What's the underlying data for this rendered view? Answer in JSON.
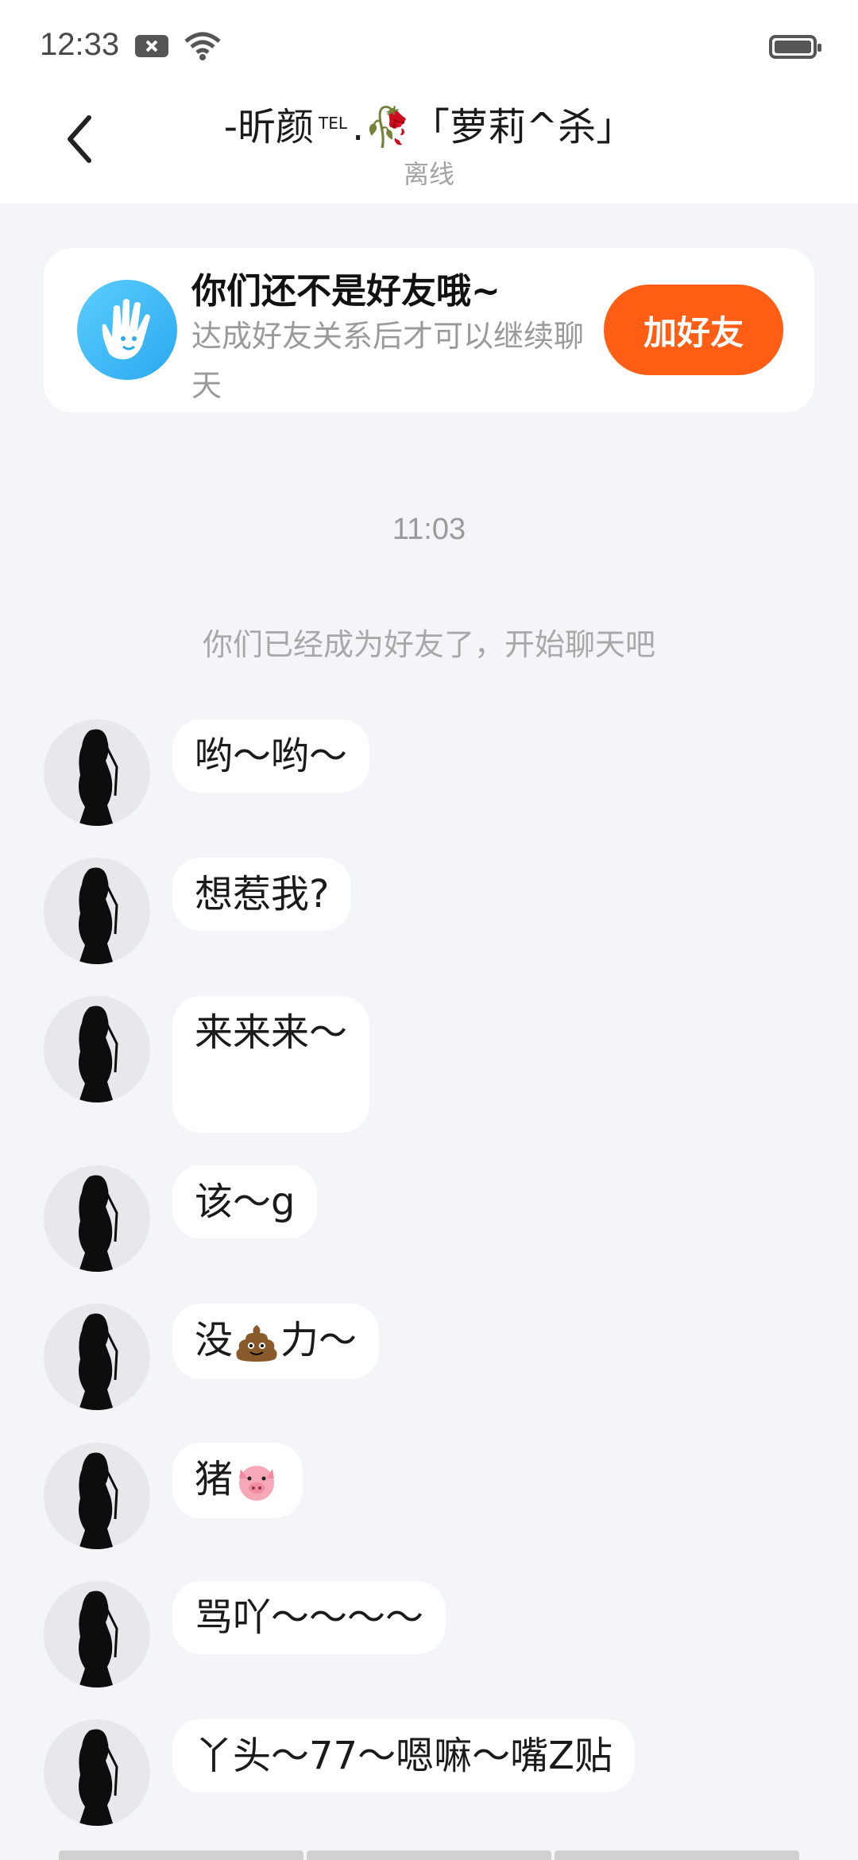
{
  "status": {
    "time": "12:33"
  },
  "header": {
    "title_prefix": "-昕颜",
    "title_tel": "TEL",
    "title_suffix": ".🥀「萝莉^杀」",
    "subtitle": "离线"
  },
  "friend_card": {
    "title": "你们还不是好友哦~",
    "desc": "达成好友关系后才可以继续聊天",
    "button": "加好友"
  },
  "timestamp": "11:03",
  "system_message": "你们已经成为好友了，开始聊天吧",
  "messages": [
    {
      "text": "哟～哟～"
    },
    {
      "text": "想惹我?"
    },
    {
      "text": "来来来～"
    },
    {
      "text": "该～g"
    },
    {
      "text_a": "没",
      "emoji": "poop-emoji",
      "text_b": "力～"
    },
    {
      "text": "猪",
      "emoji": "pig-face-emoji"
    },
    {
      "text": "骂吖～～～～"
    },
    {
      "text": "丫头～77～嗯嘛～嘴Z贴"
    }
  ]
}
